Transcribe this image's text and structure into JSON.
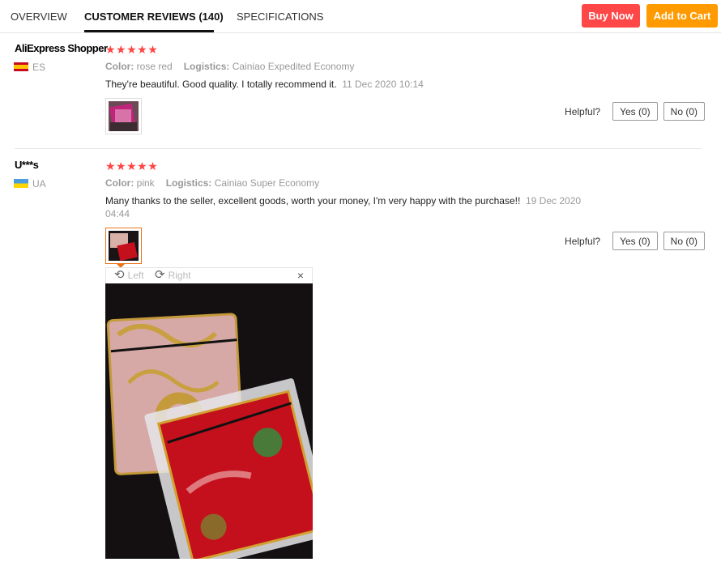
{
  "tabs": [
    {
      "label": "OVERVIEW",
      "active": false
    },
    {
      "label": "CUSTOMER REVIEWS (140)",
      "active": true
    },
    {
      "label": "SPECIFICATIONS",
      "active": false
    }
  ],
  "actions": {
    "buy_now": "Buy Now",
    "add_to_cart": "Add to Cart"
  },
  "colors": {
    "buy_now": "#ff4747",
    "add_to_cart": "#ff9a00",
    "stars": "#ff4444",
    "active_thumb": "#e8741a"
  },
  "reviews": [
    {
      "user": "AliExpress Shopper",
      "country": "ES",
      "flag_icon": "spain-flag-icon",
      "rating": "★★★★★",
      "color_label": "Color:",
      "color_value": "rose red",
      "logistics_label": "Logistics:",
      "logistics_value": "Cainiao Expedited Economy",
      "text": "They're beautiful. Good quality. I totally recommend it.",
      "date": "11 Dec 2020 10:14",
      "helpful_label": "Helpful?",
      "yes": "Yes (0)",
      "no": "No (0)"
    },
    {
      "user": "U***s",
      "country": "UA",
      "flag_icon": "ukraine-flag-icon",
      "rating": "★★★★★",
      "color_label": "Color:",
      "color_value": "pink",
      "logistics_label": "Logistics:",
      "logistics_value": "Cainiao Super Economy",
      "text": "Many thanks to the seller, excellent goods, worth your money, I'm very happy with the purchase!!",
      "date_line1": "19 Dec 2020",
      "date_line2": "04:44",
      "helpful_label": "Helpful?",
      "yes": "Yes (0)",
      "no": "No (0)"
    }
  ],
  "viewer": {
    "rotate_left": "Left",
    "rotate_right": "Right",
    "close": "×"
  }
}
